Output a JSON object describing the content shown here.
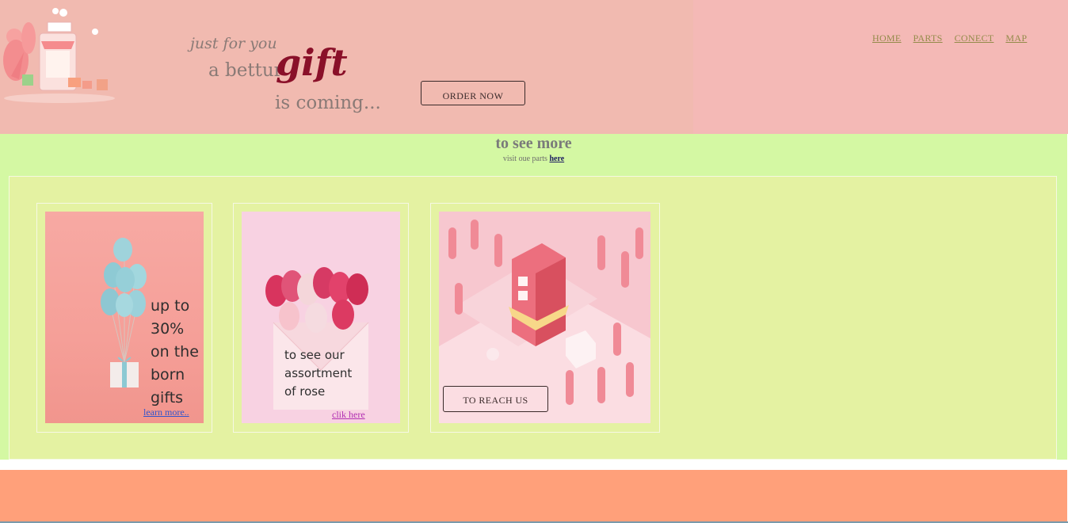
{
  "header": {
    "tagline_line1": "just for you",
    "tagline_line2": "a bettur",
    "tagline_gift": "gift",
    "tagline_line3": "is coming...",
    "order_button": "ORDER NOW",
    "nav": [
      "HOME",
      "PARTS",
      "CONECT",
      "MAP"
    ]
  },
  "see_more": {
    "title": "to see more",
    "subtitle": "visit oue parts",
    "link": "here"
  },
  "cards": [
    {
      "lines": [
        "up to",
        "30%",
        "on the",
        "born",
        "gifts"
      ],
      "link": "learn more.."
    },
    {
      "lines": [
        "to see our",
        "assortment",
        "of rose"
      ],
      "link": "clik here"
    },
    {
      "button": "TO REACH US"
    }
  ],
  "colors": {
    "header_bg": "#f4b9b6",
    "strip_bg": "#d4f8a3",
    "panel_bg": "#e4f2a2",
    "footer_bg": "#ffa07a",
    "gift_accent": "#8a1029"
  }
}
